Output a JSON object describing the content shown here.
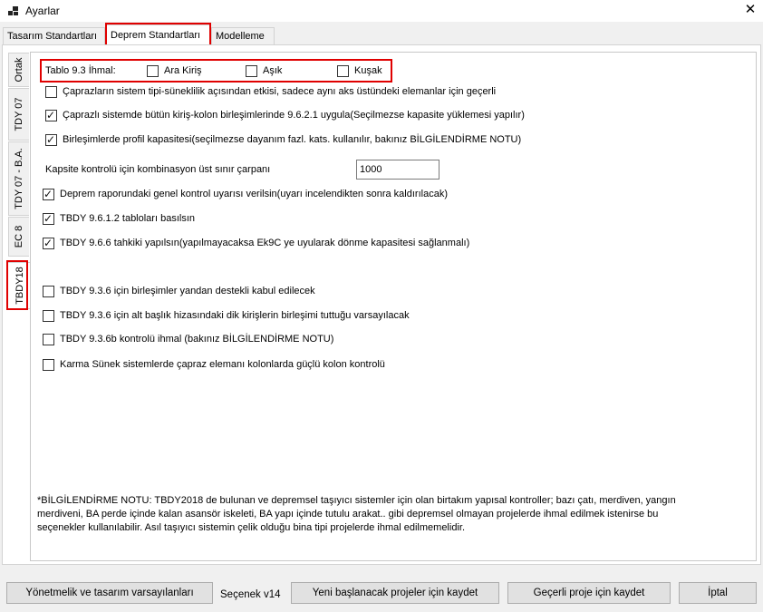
{
  "window": {
    "title": "Ayarlar",
    "close_glyph": "✕"
  },
  "top_tabs": [
    "Tasarım Standartları",
    "Deprem Standartları",
    "Modelleme"
  ],
  "side_tabs": [
    "Ortak",
    "TDY 07",
    "TDY 07 - B.A.",
    "EC 8",
    "TBDY18"
  ],
  "ihmal": {
    "label": "Tablo 9.3 İhmal:",
    "options": [
      {
        "label": "Ara Kiriş",
        "checked": false
      },
      {
        "label": "Aşık",
        "checked": false
      },
      {
        "label": "Kuşak",
        "checked": false
      }
    ]
  },
  "checkboxes_top": [
    {
      "label": "Çaprazların sistem tipi-süneklilik açısından etkisi, sadece aynı aks üstündeki elemanlar için geçerli",
      "checked": false
    },
    {
      "label": "Çaprazlı sistemde bütün kiriş-kolon birleşimlerinde 9.6.2.1 uygula(Seçilmezse kapasite yüklemesi yapılır)",
      "checked": true
    },
    {
      "label": "Birleşimlerde profil kapasitesi(seçilmezse dayanım fazl. kats. kullanılır, bakınız BİLGİLENDİRME NOTU)",
      "checked": true
    }
  ],
  "kapasite": {
    "label": "Kapsite kontrolü için kombinasyon üst sınır çarpanı",
    "value": "1000"
  },
  "checkboxes_mid": [
    {
      "label": "Deprem raporundaki genel kontrol  uyarısı verilsin(uyarı incelendikten sonra kaldırılacak)",
      "checked": true
    },
    {
      "label": "TBDY 9.6.1.2 tabloları basılsın",
      "checked": true
    },
    {
      "label": "TBDY 9.6.6 tahkiki yapılsın(yapılmayacaksa Ek9C ye uyularak dönme kapasitesi sağlanmalı)",
      "checked": true
    }
  ],
  "checkboxes_bottom": [
    {
      "label": "TBDY 9.3.6 için birleşimler yandan destekli kabul edilecek",
      "checked": false
    },
    {
      "label": "TBDY 9.3.6 için alt başlık hizasındaki dik kirişlerin birleşimi tuttuğu varsayılacak",
      "checked": false
    },
    {
      "label": "TBDY 9.3.6b kontrolü ihmal (bakınız BİLGİLENDİRME NOTU)",
      "checked": false
    },
    {
      "label": "Karma Sünek sistemlerde çapraz elemanı kolonlarda güçlü kolon kontrolü",
      "checked": false
    }
  ],
  "note": {
    "line1": "*BİLGİLENDİRME NOTU:  TBDY2018 de bulunan ve depremsel taşıyıcı sistemler için olan birtakım yapısal kontroller; bazı çatı, merdiven, yangın",
    "line2": "merdiveni, BA perde içinde kalan asansör iskeleti, BA yapı içinde tutulu arakat.. gibi depremsel olmayan projelerde ihmal edilmek istenirse bu",
    "line3": "seçenekler kullanılabilir. Asıl taşıyıcı sistemin çelik olduğu bina tipi projelerde ihmal edilmemelidir."
  },
  "footer": {
    "defaults_button": "Yönetmelik ve tasarım varsayılanları",
    "version": "Seçenek v14",
    "save_new_button": "Yeni başlanacak projeler için kaydet",
    "save_current_button": "Geçerli proje için kaydet",
    "cancel_button": "İptal"
  },
  "colors": {
    "highlight": "#e00000",
    "window_bg": "#f0f0f0",
    "panel_bg": "#ffffff"
  }
}
